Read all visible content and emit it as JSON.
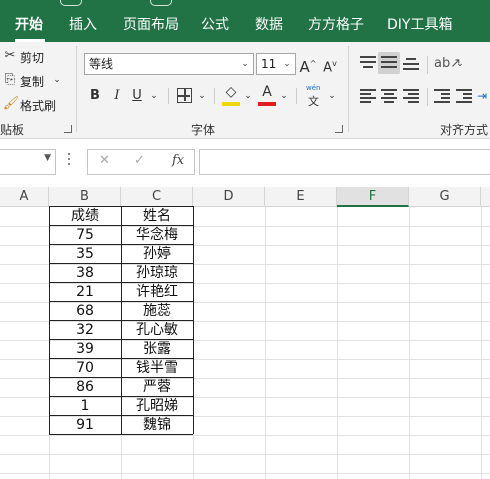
{
  "tabs": [
    "开始",
    "插入",
    "页面布局",
    "公式",
    "数据",
    "方方格子",
    "DIY工具箱"
  ],
  "clipboard": {
    "cut": "剪切",
    "copy": "复制",
    "format_painter": "格式刷",
    "group": "贴板"
  },
  "font": {
    "name": "等线",
    "size": "11",
    "group": "字体",
    "grow": "A",
    "shrink": "A",
    "bold": "B",
    "italic": "I",
    "underline": "U",
    "font_color_glyph": "A",
    "fill_color": "#f2d600",
    "text_color": "#e02020",
    "phonetic_top": "wén",
    "phonetic_bottom": "文"
  },
  "alignment": {
    "group": "对齐方式"
  },
  "formula_bar": {
    "cancel": "✕",
    "confirm": "✓",
    "fx": "fx",
    "value": ""
  },
  "columns": [
    "A",
    "B",
    "C",
    "D",
    "E",
    "F",
    "G"
  ],
  "selected_column": "F",
  "table": {
    "headers": [
      "成绩",
      "姓名"
    ],
    "rows": [
      [
        "75",
        "华念梅"
      ],
      [
        "35",
        "孙婷"
      ],
      [
        "38",
        "孙琼琼"
      ],
      [
        "21",
        "许艳红"
      ],
      [
        "68",
        "施蕊"
      ],
      [
        "32",
        "孔心敏"
      ],
      [
        "39",
        "张露"
      ],
      [
        "70",
        "钱半雪"
      ],
      [
        "86",
        "严蓉"
      ],
      [
        "1",
        "孔昭娣"
      ],
      [
        "91",
        "魏锦"
      ]
    ]
  },
  "colors": {
    "accent": "#217346"
  }
}
